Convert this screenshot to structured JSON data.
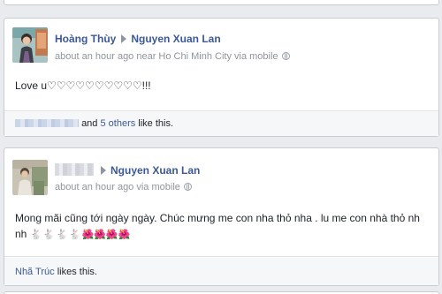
{
  "posts": [
    {
      "author": "Hoàng Thùy",
      "target": "Nguyen Xuan Lan",
      "meta": "about an hour ago near Ho Chi Minh City via mobile",
      "text": "Love u♡♡♡♡♡♡♡♡♡♡!!!",
      "likes": {
        "others_link": "5 others",
        "prefix": "and",
        "suffix": "like this."
      }
    },
    {
      "target": "Nguyen Xuan Lan",
      "meta": "about an hour ago via mobile",
      "text": "Mong mãi cũng tới ngày ngày. Chúc mưng me con nha thỏ nha . lu me con nhà thỏ nh nh",
      "rabbit_emoji": "🐇🐇🐇🐇",
      "flower_emoji": "🌺🌺🌺🌺",
      "likes": {
        "liker": "Nhã Trúc",
        "suffix": "likes this."
      }
    }
  ],
  "colors": {
    "link": "#3b5998",
    "meta": "#90949c",
    "background": "#e9ebee"
  }
}
